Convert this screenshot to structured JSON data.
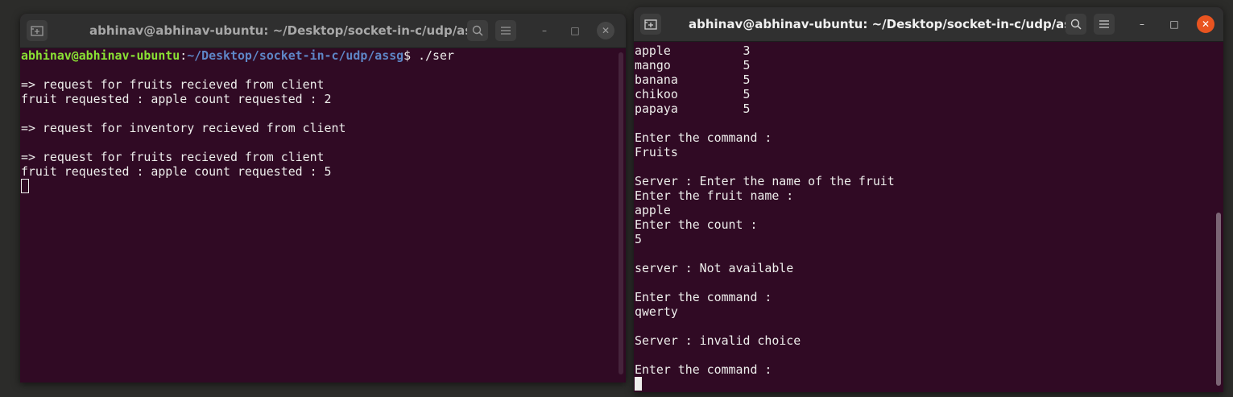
{
  "left_window": {
    "title": "abhinav@abhinav-ubuntu: ~/Desktop/socket-in-c/udp/assg",
    "new_tab_icon": "new-tab-icon",
    "search_icon": "search-icon",
    "menu_icon": "hamburger-menu-icon",
    "minimize_label": "–",
    "maximize_label": "□",
    "close_label": "✕",
    "prompt_user": "abhinav@abhinav-ubuntu",
    "prompt_sep": ":",
    "prompt_path": "~/Desktop/socket-in-c/udp/assg",
    "prompt_cmd": "$ ./ser",
    "lines": [
      "",
      "=> request for fruits recieved from client",
      "fruit requested : apple count requested : 2",
      "",
      "=> request for inventory recieved from client",
      "",
      "=> request for fruits recieved from client",
      "fruit requested : apple count requested : 5"
    ]
  },
  "right_window": {
    "title": "abhinav@abhinav-ubuntu: ~/Desktop/socket-in-c/udp/assg",
    "new_tab_icon": "new-tab-icon",
    "search_icon": "search-icon",
    "menu_icon": "hamburger-menu-icon",
    "minimize_label": "–",
    "maximize_label": "□",
    "close_label": "✕",
    "lines": [
      "apple          3",
      "mango          5",
      "banana         5",
      "chikoo         5",
      "papaya         5",
      "",
      "Enter the command :",
      "Fruits",
      "",
      "Server : Enter the name of the fruit",
      "Enter the fruit name :",
      "apple",
      "Enter the count :",
      "5",
      "",
      "server : Not available",
      "",
      "Enter the command :",
      "qwerty",
      "",
      "Server : invalid choice",
      "",
      "Enter the command :"
    ]
  },
  "colors": {
    "terminal_bg": "#300a24",
    "prompt_user": "#8ae234",
    "prompt_path": "#5e86c6",
    "close_active": "#e95420"
  }
}
